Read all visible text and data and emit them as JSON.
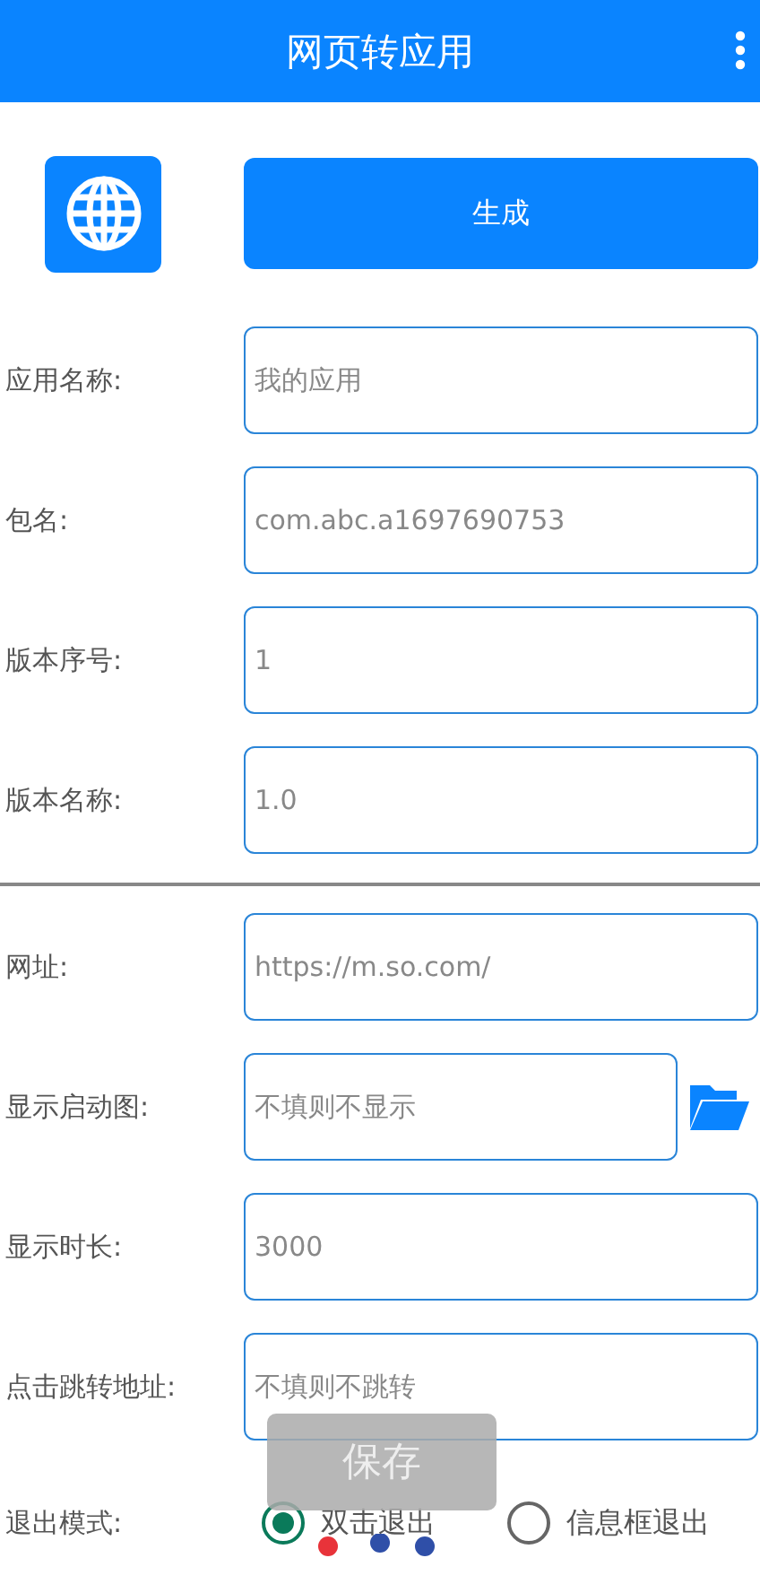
{
  "app_bar": {
    "title": "网页转应用"
  },
  "generate_button": "生成",
  "fields_top": [
    {
      "label": "应用名称:",
      "value": "我的应用"
    },
    {
      "label": "包名:",
      "value": "com.abc.a1697690753"
    },
    {
      "label": "版本序号:",
      "value": "1"
    },
    {
      "label": "版本名称:",
      "value": "1.0"
    }
  ],
  "fields_bottom": [
    {
      "label": "网址:",
      "value": "https://m.so.com/",
      "kind": "text"
    },
    {
      "label": "显示启动图:",
      "placeholder": "不填则不显示",
      "kind": "file"
    },
    {
      "label": "显示时长:",
      "value": "3000",
      "kind": "text"
    },
    {
      "label": "点击跳转地址:",
      "placeholder": "不填则不跳转",
      "kind": "text"
    }
  ],
  "exit_mode": {
    "label": "退出模式:",
    "options": [
      {
        "label": "双击退出",
        "selected": true
      },
      {
        "label": "信息框退出",
        "selected": false
      }
    ]
  },
  "toast_button": "保存"
}
